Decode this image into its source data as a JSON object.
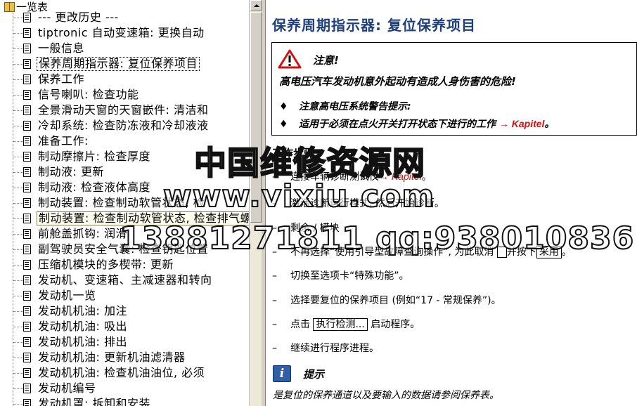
{
  "tree": {
    "root_label": "一览表",
    "items": [
      {
        "label": "--- 更改历史 ---"
      },
      {
        "label": "tiptronic 自动变速箱: 更换自动"
      },
      {
        "label": "一般信息"
      },
      {
        "label": "保养周期指示器: 复位保养项目",
        "selected": true
      },
      {
        "label": "保养工作"
      },
      {
        "label": "信号喇叭: 检查功能"
      },
      {
        "label": "全景滑动天窗的天窗嵌件: 清洁和"
      },
      {
        "label": "冷却系统: 检查防冻液和冷却液液"
      },
      {
        "label": "准备工作:"
      },
      {
        "label": "制动摩擦片: 检查厚度"
      },
      {
        "label": "制动液: 更新"
      },
      {
        "label": "制动液: 检查液体高度"
      },
      {
        "label": "制动装置: 检查制动软管状态, 检"
      },
      {
        "label": "制动装置: 检查制动软管状态, 检查排气螺栓的护罩",
        "hover": true
      },
      {
        "label": "前舱盖抓钩: 润滑"
      },
      {
        "label": "副驾驶员安全气囊: 检查钥匙位置"
      },
      {
        "label": "压缩机模块的多楔带: 更新"
      },
      {
        "label": "发动机、变速箱、主减速器和转向"
      },
      {
        "label": "发动机一览"
      },
      {
        "label": "发动机机油: 加注"
      },
      {
        "label": "发动机机油: 吸出"
      },
      {
        "label": "发动机机油: 排出"
      },
      {
        "label": "发动机机油: 更新机油滤清器"
      },
      {
        "label": "发动机机油: 检查机油油位, 必须"
      },
      {
        "label": "发动机编号"
      },
      {
        "label": "发动机罩: 拆卸和安装"
      }
    ]
  },
  "content": {
    "title": "保养周期指示器: 复位保养项目",
    "warning": {
      "heading": "注意!",
      "line1": "高电压汽车发动机意外起动有造成人身伤害的危险!",
      "bullets": [
        {
          "text": "注意高电压系统警告提示:"
        },
        {
          "text": "适用于必须在点火开关打开状态下进行的工作",
          "link": "→ Kapitel",
          "tail": "。"
        }
      ],
      "bullet_symbol": "♦"
    },
    "steps_heading": "工作步骤:",
    "steps": [
      {
        "pre": "连接车辆诊断测试仪",
        "link": "→ Kapitel",
        "post": "。"
      },
      {
        "pre": "激活诊断运行模式, 然后开始诊断。"
      },
      {
        "pre": "剩余 / 模块"
      },
      {
        "pre": "不再选择“使用引导型故障查询操作”, 为此取消",
        "box1": "",
        "mid": "并按下",
        "box2": "采用",
        "post": "。"
      },
      {
        "pre": "切换至选项卡“特殊功能”。"
      },
      {
        "pre": "选择要复位的保养项目 (例如“17 - 常规保养”)。"
      },
      {
        "pre": "点击",
        "box1": "执行检测...",
        "post": "启动程序。"
      },
      {
        "pre": "继续进行程序进程。"
      }
    ],
    "step_dash": "–",
    "hint": {
      "icon_letter": "i",
      "heading": "提示",
      "text": "是复位的保养通道以及要输入的数据请参阅保养表。"
    }
  },
  "watermark": {
    "line1": "中国维修资源网",
    "line2": "www.vixiu.com",
    "line3": "13881271811 qq:938010836"
  },
  "colors": {
    "title_blue": "#1f3f7a",
    "link_red": "#d41010",
    "hint_blue": "#2f5fa8"
  }
}
